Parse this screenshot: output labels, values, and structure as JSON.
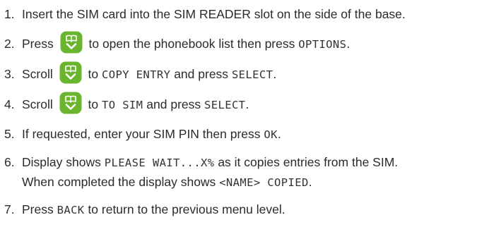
{
  "steps": [
    {
      "num": "1.",
      "text": "Insert the SIM card into the SIM READER slot on the side of the base."
    },
    {
      "num": "2.",
      "pre": "Press",
      "mid": "to open the phonebook list then press",
      "lcd1": "OPTIONS",
      "end": "."
    },
    {
      "num": "3.",
      "pre": "Scroll",
      "mid": "to",
      "lcd1": "COPY ENTRY",
      "mid2": "and press",
      "lcd2": "SELECT",
      "end": "."
    },
    {
      "num": "4.",
      "pre": "Scroll",
      "mid": "to",
      "lcd1": "TO SIM",
      "mid2": "and press",
      "lcd2": "SELECT",
      "end": "."
    },
    {
      "num": "5.",
      "pre": "If requested, enter your SIM PIN then press",
      "lcd1": "OK",
      "end": "."
    },
    {
      "num": "6.",
      "pre": "Display shows",
      "lcd1": "PLEASE WAIT...X%",
      "mid": "as it copies entries from the SIM.",
      "line2_pre": "When completed the display shows",
      "lcd2": "<NAME> COPIED",
      "end": "."
    },
    {
      "num": "7.",
      "pre": "Press",
      "lcd1": "BACK",
      "mid": "to return to the previous menu level."
    }
  ],
  "icons": {
    "key": "phonebook-down-key-icon"
  },
  "colors": {
    "key_fill": "#6bb52e",
    "key_symbol": "#ffffff",
    "text": "#2b2b2b"
  }
}
